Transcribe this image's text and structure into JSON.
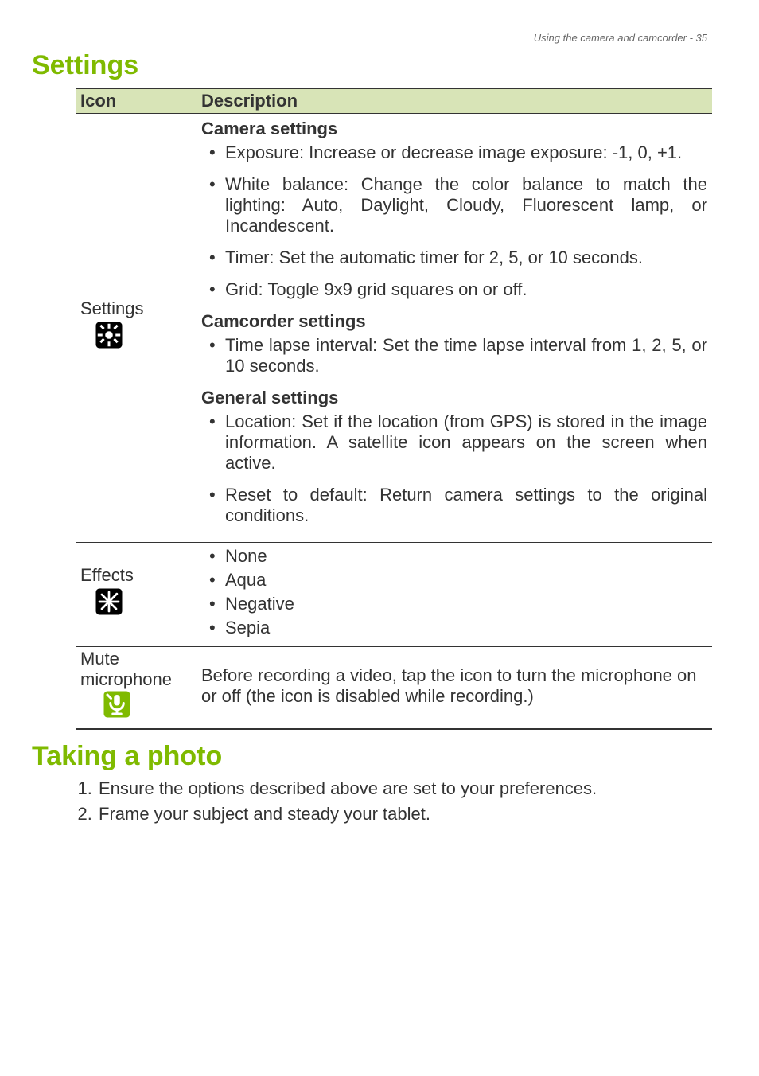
{
  "header": {
    "running_head": "Using the camera and camcorder - 35"
  },
  "sections": {
    "settings_title": "Settings",
    "taking_photo_title": "Taking a photo"
  },
  "table": {
    "head_icon": "Icon",
    "head_desc": "Description",
    "rows": {
      "settings": {
        "icon_label": "Settings",
        "camera_head": "Camera settings",
        "camera_items": [
          "Exposure: Increase or decrease image exposure: -1, 0, +1.",
          "White balance: Change the color balance to match the lighting: Auto, Daylight, Cloudy, Fluorescent lamp, or Incandescent.",
          "Timer: Set the automatic timer for 2, 5, or 10 seconds.",
          "Grid: Toggle 9x9 grid squares on or off."
        ],
        "camcorder_head": "Camcorder settings",
        "camcorder_items": [
          "Time lapse interval: Set the time lapse interval from 1, 2, 5, or 10 seconds."
        ],
        "general_head": "General settings",
        "general_items": [
          "Location: Set if the location (from GPS) is stored in the image information. A satellite icon appears on the screen when active.",
          "Reset to default: Return camera settings to the original conditions."
        ]
      },
      "effects": {
        "icon_label": "Effects",
        "items": [
          "None",
          "Aqua",
          "Negative",
          "Sepia"
        ]
      },
      "mute": {
        "icon_label_line1": "Mute",
        "icon_label_line2": "microphone",
        "desc": "Before recording a video, tap the icon to turn the microphone on or off (the icon is disabled while recording.)"
      }
    }
  },
  "steps": [
    "Ensure the options described above are set to your preferences.",
    "Frame your subject and steady your tablet."
  ]
}
